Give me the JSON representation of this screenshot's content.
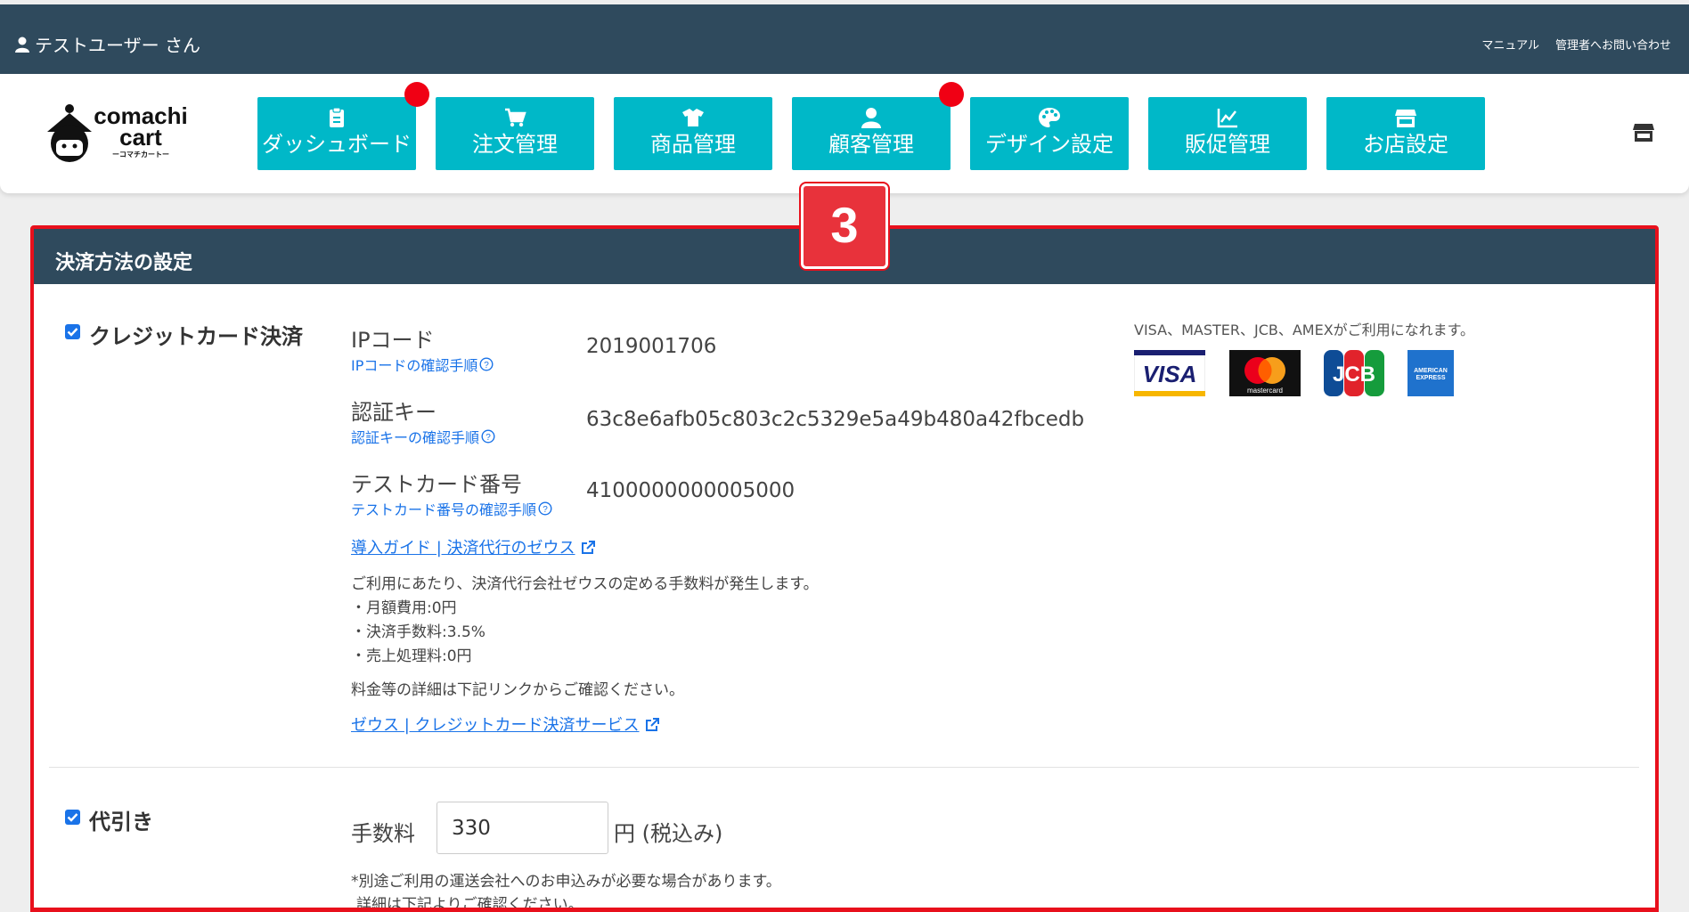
{
  "topbar": {
    "user": "テストユーザー さん",
    "links": [
      "マニュアル",
      "管理者へお問い合わせ"
    ]
  },
  "logo": {
    "line1": "comachi",
    "line2": "cart",
    "sub": "ーコマチカートー"
  },
  "nav": [
    {
      "label": "ダッシュボード",
      "icon": "clipboard-icon"
    },
    {
      "label": "注文管理",
      "icon": "cart-icon"
    },
    {
      "label": "商品管理",
      "icon": "shirt-icon"
    },
    {
      "label": "顧客管理",
      "icon": "person-icon"
    },
    {
      "label": "デザイン設定",
      "icon": "palette-icon"
    },
    {
      "label": "販促管理",
      "icon": "chart-icon"
    },
    {
      "label": "お店設定",
      "icon": "store-icon"
    }
  ],
  "step_badge": "3",
  "panel": {
    "title": "決済方法の設定",
    "credit": {
      "title": "クレジットカード決済",
      "checked": true,
      "ip_label": "IPコード",
      "ip_link": "IPコードの確認手順",
      "ip_value": "2019001706",
      "key_label": "認証キー",
      "key_link": "認証キーの確認手順",
      "key_value": "63c8e6afb05c803c2c5329e5a49b480a42fbcedb",
      "card_label": "テストカード番号",
      "card_link": "テストカード番号の確認手順",
      "card_value": "4100000000005000",
      "guide_link": "導入ガイド | 決済代行のゼウス",
      "fee_intro": "ご利用にあたり、決済代行会社ゼウスの定める手数料が発生します。",
      "fee_lines": [
        "・月額費用:0円",
        "・決済手数料:3.5%",
        "・売上処理料:0円"
      ],
      "detail_note": "料金等の詳細は下記リンクからご確認ください。",
      "service_link": "ゼウス | クレジットカード決済サービス",
      "brands_note": "VISA、MASTER、JCB、AMEXがご利用になれます。",
      "brands": [
        "VISA",
        "mastercard",
        "JCB",
        "AMERICAN EXPRESS"
      ]
    },
    "cod": {
      "title": "代引き",
      "checked": true,
      "fee_label": "手数料",
      "fee_value": "330",
      "fee_unit": "円 (税込み)",
      "note1": "*別途ご利用の運送会社へのお申込みが必要な場合があります。",
      "note2": "詳細は下記よりご確認ください。"
    }
  },
  "colors": {
    "header": "#2f4a5d",
    "nav_button": "#00b8c8",
    "badge": "#f00014",
    "highlight": "#e8101c",
    "link": "#1a73e8"
  }
}
